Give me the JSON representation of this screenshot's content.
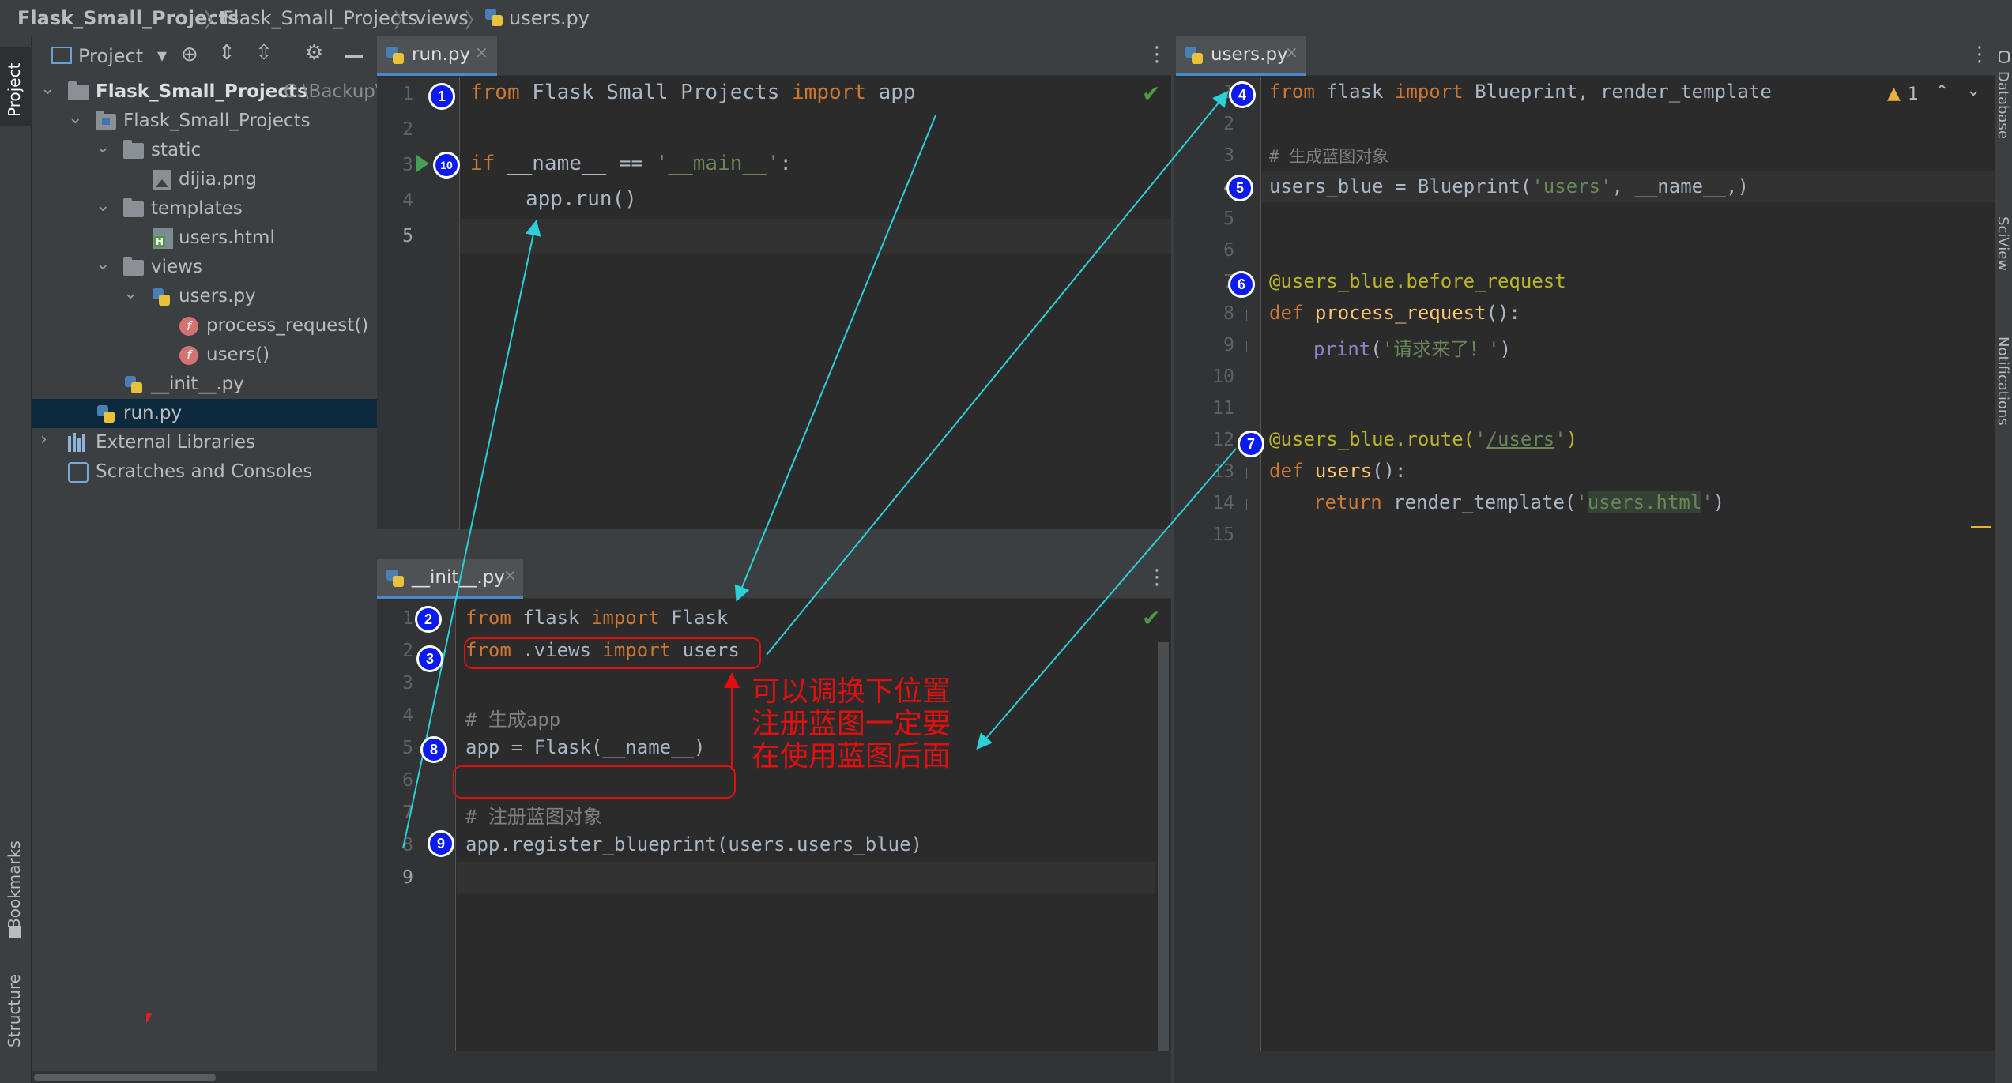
{
  "breadcrumb": {
    "project": "Flask_Small_Projects",
    "folder": "Flask_Small_Projects",
    "subfolder": "views",
    "file": "users.py"
  },
  "toolstrip": {
    "left": [
      "Project",
      "Bookmarks",
      "Structure"
    ],
    "right": [
      "Database",
      "SciView",
      "Notifications"
    ]
  },
  "project_panel": {
    "title": "Project",
    "tree": [
      {
        "label": "Flask_Small_Projects",
        "path": "C:\\Backup\\"
      },
      {
        "label": "Flask_Small_Projects"
      },
      {
        "label": "static"
      },
      {
        "label": "dijia.png"
      },
      {
        "label": "templates"
      },
      {
        "label": "users.html"
      },
      {
        "label": "views"
      },
      {
        "label": "users.py"
      },
      {
        "label": "process_request()"
      },
      {
        "label": "users()"
      },
      {
        "label": "__init__.py"
      },
      {
        "label": "run.py"
      },
      {
        "label": "External Libraries"
      },
      {
        "label": "Scratches and Consoles"
      }
    ],
    "selected": "run.py"
  },
  "editors": {
    "run": {
      "tab": "run.py",
      "line_numbers": [
        "1",
        "2",
        "3",
        "4",
        "5"
      ],
      "code": {
        "l1_kw": "from",
        "l1_mod": "Flask_Small_Projects",
        "l1_kw2": "import",
        "l1_name": "app",
        "l3_kw": "if",
        "l3_a": "__name__ == ",
        "l3_str": "'__main__'",
        "l3_b": ":",
        "l4": "app.run()"
      }
    },
    "init": {
      "tab": "__init__.py",
      "line_numbers": [
        "1",
        "2",
        "3",
        "4",
        "5",
        "6",
        "7",
        "8",
        "9"
      ],
      "code": {
        "l1_kw": "from",
        "l1_mod": "flask",
        "l1_kw2": "import",
        "l1_name": "Flask",
        "l2_kw": "from",
        "l2_mod": ".views",
        "l2_kw2": "import",
        "l2_name": "users",
        "l4": "# 生成app",
        "l5": "app = Flask(__name__)",
        "l7": "# 注册蓝图对象",
        "l8": "app.register_blueprint(users.users_blue)"
      }
    },
    "users": {
      "tab": "users.py",
      "warning_count": "1",
      "line_numbers": [
        "1",
        "2",
        "3",
        "4",
        "5",
        "6",
        "7",
        "8",
        "9",
        "10",
        "11",
        "12",
        "13",
        "14",
        "15"
      ],
      "code": {
        "l1_kw": "from",
        "l1_mod": "flask",
        "l1_kw2": "import",
        "l1_name": "Blueprint, render_template",
        "l3": "# 生成蓝图对象",
        "l4_a": "users_blue = Blueprint(",
        "l4_s": "'users'",
        "l4_b": ", __name__,)",
        "l7": "@users_blue.before_request",
        "l8_kw": "def",
        "l8_fn": "process_request",
        "l8_b": "():",
        "l9_fn": "print",
        "l9_a": "(",
        "l9_s": "'请求来了！'",
        "l9_b": ")",
        "l12_a": "@users_blue.route(",
        "l12_q1": "'",
        "l12_s": "/users",
        "l12_q2": "'",
        "l12_b": ")",
        "l13_kw": "def",
        "l13_fn": "users",
        "l13_b": "():",
        "l14_kw": "return",
        "l14_a": "render_template(",
        "l14_q1": "'",
        "l14_s": "users.html",
        "l14_q2": "'",
        "l14_b": ")"
      }
    }
  },
  "annotations": {
    "badges": [
      "1",
      "2",
      "3",
      "4",
      "5",
      "6",
      "7",
      "8",
      "9",
      "10"
    ],
    "note_lines": [
      "可以调换下位置",
      "注册蓝图一定要",
      "在使用蓝图后面"
    ]
  },
  "colors": {
    "keyword": "#cc7832",
    "string": "#6a8759",
    "comment": "#808080",
    "decorator": "#bbb529",
    "function": "#ffc66d",
    "badge": "#0b1bf0",
    "arrow": "#2ad1d8",
    "note": "#e01010",
    "selection": "#0d293e"
  }
}
